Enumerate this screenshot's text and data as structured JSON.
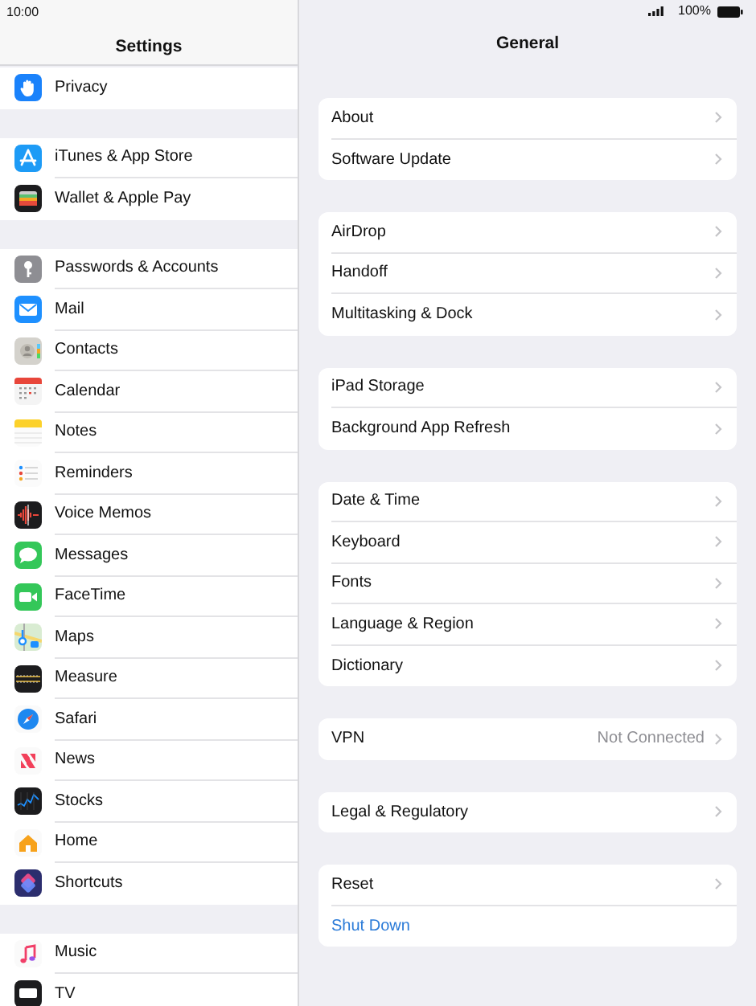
{
  "status_bar": {
    "time": "10:00",
    "battery": "100%"
  },
  "sidebar": {
    "title": "Settings",
    "groups": [
      {
        "items": [
          {
            "label": "Privacy"
          }
        ]
      },
      {
        "items": [
          {
            "label": "iTunes & App Store"
          },
          {
            "label": "Wallet & Apple Pay"
          }
        ]
      },
      {
        "items": [
          {
            "label": "Passwords & Accounts"
          },
          {
            "label": "Mail"
          },
          {
            "label": "Contacts"
          },
          {
            "label": "Calendar"
          },
          {
            "label": "Notes"
          },
          {
            "label": "Reminders"
          },
          {
            "label": "Voice Memos"
          },
          {
            "label": "Messages"
          },
          {
            "label": "FaceTime"
          },
          {
            "label": "Maps"
          },
          {
            "label": "Measure"
          },
          {
            "label": "Safari"
          },
          {
            "label": "News"
          },
          {
            "label": "Stocks"
          },
          {
            "label": "Home"
          },
          {
            "label": "Shortcuts"
          }
        ]
      },
      {
        "items": [
          {
            "label": "Music"
          },
          {
            "label": "TV"
          }
        ]
      }
    ]
  },
  "detail": {
    "title": "General",
    "groups": [
      {
        "rows": [
          {
            "label": "About",
            "kind": "link"
          },
          {
            "label": "Software Update",
            "kind": "link"
          }
        ]
      },
      {
        "rows": [
          {
            "label": "AirDrop",
            "kind": "link"
          },
          {
            "label": "Handoff",
            "kind": "link"
          },
          {
            "label": "Multitasking & Dock",
            "kind": "link"
          }
        ]
      },
      {
        "rows": [
          {
            "label": "iPad Storage",
            "kind": "link"
          },
          {
            "label": "Background App Refresh",
            "kind": "link"
          }
        ]
      },
      {
        "rows": [
          {
            "label": "Date & Time",
            "kind": "link"
          },
          {
            "label": "Keyboard",
            "kind": "link"
          },
          {
            "label": "Fonts",
            "kind": "link"
          },
          {
            "label": "Language & Region",
            "kind": "link"
          },
          {
            "label": "Dictionary",
            "kind": "link"
          }
        ]
      },
      {
        "rows": [
          {
            "label": "VPN",
            "value": "Not Connected",
            "kind": "link"
          }
        ]
      },
      {
        "rows": [
          {
            "label": "Legal & Regulatory",
            "kind": "link"
          }
        ]
      },
      {
        "rows": [
          {
            "label": "Reset",
            "kind": "link"
          },
          {
            "label": "Shut Down",
            "kind": "action"
          }
        ]
      }
    ]
  }
}
